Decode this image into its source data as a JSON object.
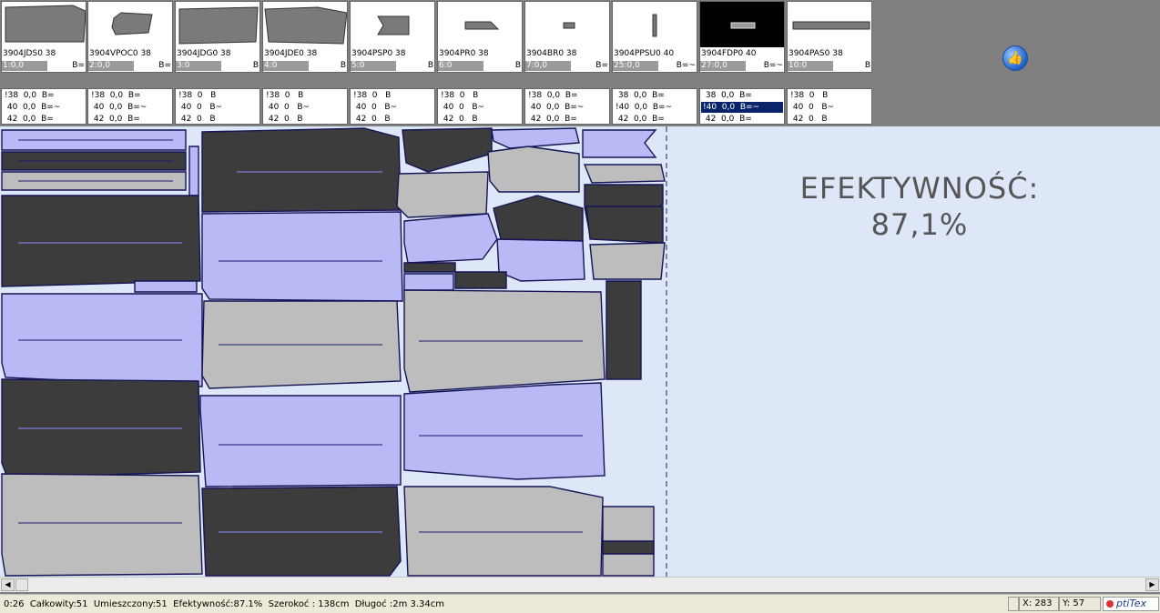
{
  "pieces": [
    {
      "name": "3904JDS0 38",
      "value": "1:0,0",
      "flag": "B="
    },
    {
      "name": "3904VPOC0 38",
      "value": "2:0,0",
      "flag": "B="
    },
    {
      "name": "3904JDG0 38",
      "value": "3:0",
      "flag": "B"
    },
    {
      "name": "3904JDE0 38",
      "value": "4:0",
      "flag": "B"
    },
    {
      "name": "3904PSP0 38",
      "value": "5:0",
      "flag": "B"
    },
    {
      "name": "3904PR0 38",
      "value": "6:0",
      "flag": "B"
    },
    {
      "name": "3904BR0 38",
      "value": "7:0,0",
      "flag": "B="
    },
    {
      "name": "3904PPSU0 40",
      "value": "25:0,0",
      "flag": "B=~"
    },
    {
      "name": "3904FDP0 40",
      "value": "27:0,0",
      "flag": "B=~"
    },
    {
      "name": "3904PAS0 38",
      "value": "10:0",
      "flag": "B"
    }
  ],
  "sizes": [
    [
      "!38  0,0  B=",
      " 40  0,0  B=~",
      " 42  0,0  B="
    ],
    [
      "!38  0,0  B=",
      " 40  0,0  B=~",
      " 42  0,0  B="
    ],
    [
      "!38  0   B",
      " 40  0   B~",
      " 42  0   B"
    ],
    [
      "!38  0   B",
      " 40  0   B~",
      " 42  0   B"
    ],
    [
      "!38  0   B",
      " 40  0   B~",
      " 42  0   B"
    ],
    [
      "!38  0   B",
      " 40  0   B~",
      " 42  0   B"
    ],
    [
      "!38  0,0  B=",
      " 40  0,0  B=~",
      " 42  0,0  B="
    ],
    [
      " 38  0,0  B=",
      "!40  0,0  B=~",
      " 42  0,0  B="
    ],
    [
      " 38  0,0  B=",
      "!40  0,0  B=~",
      " 42  0,0  B="
    ],
    [
      "!38  0   B",
      " 40  0   B~",
      " 42  0   B"
    ]
  ],
  "efficiency": {
    "label": "EFEKTYWNOŚĆ:",
    "value": "87,1%"
  },
  "status": {
    "text": "0:26  Całkowity:51  Umieszczony:51  Efektywność:87.1%  Szerokoć : 138cm  Długoć :2m 3.34cm",
    "x": "X: 283",
    "y": "Y: 57",
    "logo": "ptiTex"
  },
  "icons": {
    "like": "thumbs-up-icon",
    "scroll_left": "arrow-left-icon",
    "scroll_right": "arrow-right-icon"
  },
  "colors": {
    "dark": "#3c3c3c",
    "light": "#bdbdbd",
    "lilac": "#b9b9f5",
    "outline": "#141456",
    "canvas": "#dde7f7"
  }
}
